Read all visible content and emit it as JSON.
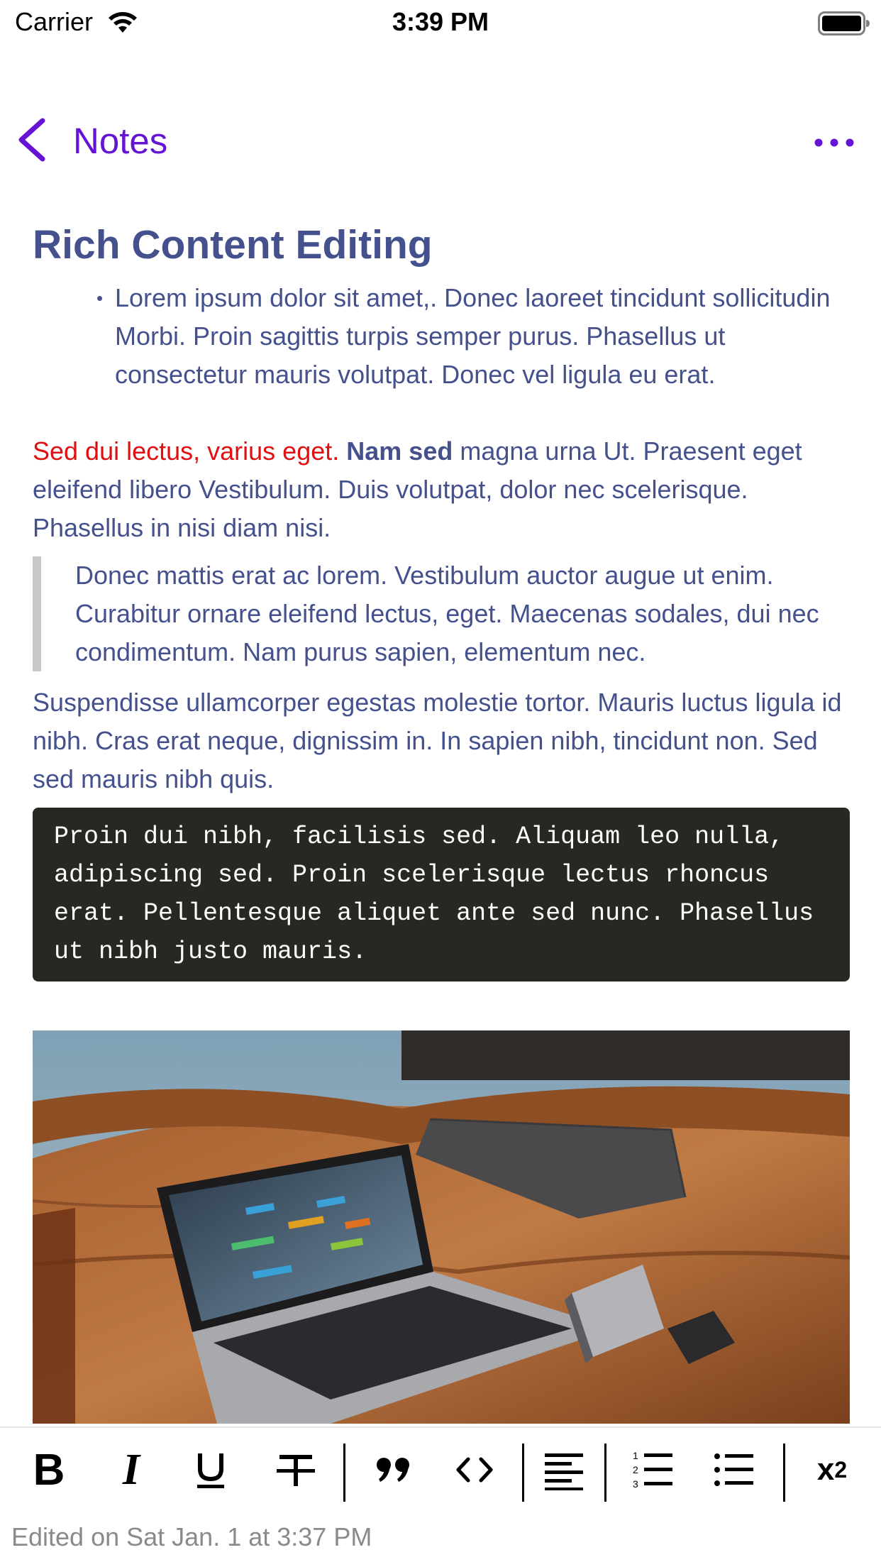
{
  "status_bar": {
    "carrier": "Carrier",
    "time": "3:39 PM"
  },
  "nav": {
    "back_label": "Notes",
    "more_icon": "ellipsis-icon",
    "accent_color": "#6514d6"
  },
  "note": {
    "title": "Rich Content Editing",
    "bullet_items": [
      "Lorem ipsum dolor sit amet,. Donec laoreet tincidunt sollicitudin Morbi. Proin sagittis turpis semper purus. Phasellus ut consectetur mauris volutpat. Donec vel ligula eu erat."
    ],
    "para1_red": "Sed dui lectus, varius eget.",
    "para1_bold": "Nam sed",
    "para1_rest": "magna urna Ut. Praesent eget eleifend libero Vestibulum. Duis volutpat, dolor nec scelerisque. Phasellus in nisi diam nisi.",
    "quote": "Donec mattis erat ac lorem. Vestibulum auctor augue ut enim. Curabitur ornare eleifend lectus, eget. Maecenas sodales, dui nec condimentum. Nam purus sapien, elementum nec.",
    "para2": "Suspendisse ullamcorper egestas molestie tortor. Mauris luctus ligula id nibh. Cras erat neque, dignissim in. In sapien nibh, tincidunt non. Sed sed mauris nibh quis.",
    "code": "Proin dui nibh, facilisis sed. Aliquam leo nulla, adipiscing sed. Proin scelerisque lectus rhoncus erat. Pellentesque aliquet ante sed nunc. Phasellus ut nibh justo mauris.",
    "text_color": "#45518d",
    "red_color": "#e01010",
    "code_bg": "#272822"
  },
  "toolbar": {
    "bold": "B",
    "italic": "I",
    "subscript_base": "x",
    "subscript_index": "2"
  },
  "footer": {
    "edited": "Edited on Sat Jan. 1 at 3:37 PM"
  }
}
